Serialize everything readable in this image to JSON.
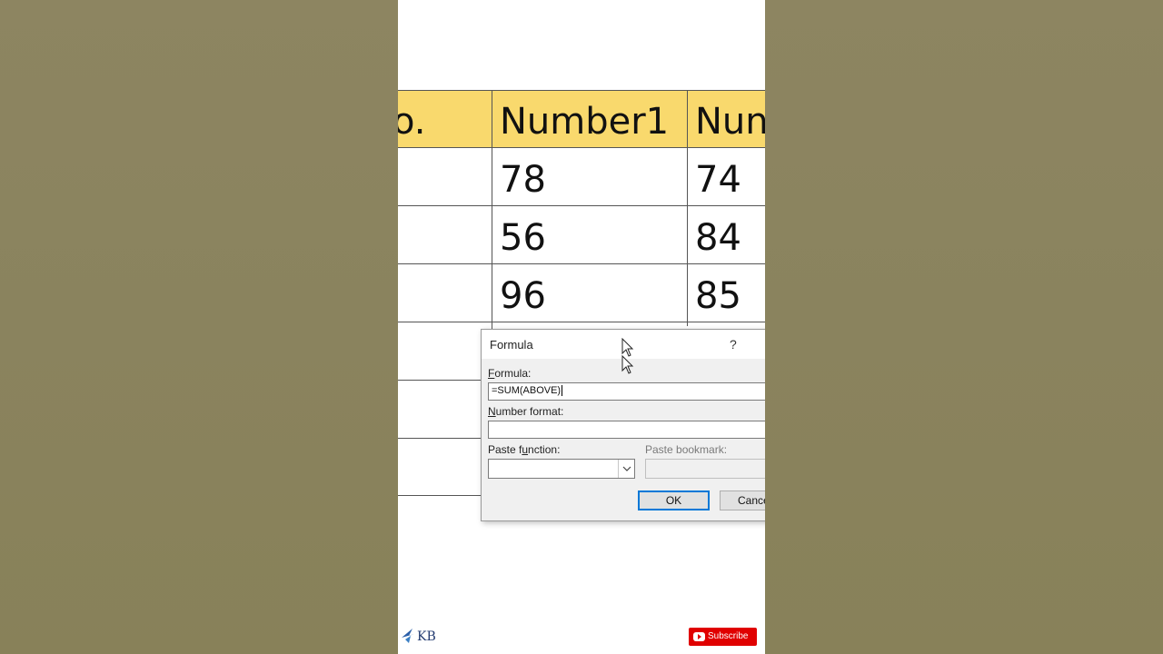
{
  "table": {
    "headers": [
      "o.",
      "Number1",
      "Nun"
    ],
    "rows": [
      {
        "number1": "78",
        "number2": "74"
      },
      {
        "number1": "56",
        "number2": "84"
      },
      {
        "number1": "96",
        "number2": "85"
      }
    ],
    "header_color": "#f9d96d"
  },
  "dialog": {
    "title": "Formula",
    "help": "?",
    "formula_label": "Formula:",
    "formula_value": "=SUM(ABOVE)",
    "number_format_label": "Number format:",
    "number_format_value": "",
    "paste_function_label": "Paste function:",
    "paste_function_value": "",
    "paste_bookmark_label": "Paste bookmark:",
    "paste_bookmark_value": "",
    "ok_label": "OK",
    "cancel_label": "Cance"
  },
  "branding": {
    "logo_text": "KB",
    "subscribe_label": "Subscribe",
    "subscribe_color": "#e00000"
  },
  "icons": [
    "mouse-pointer-icon",
    "chevron-down-icon",
    "youtube-icon",
    "kb-logo-icon"
  ]
}
